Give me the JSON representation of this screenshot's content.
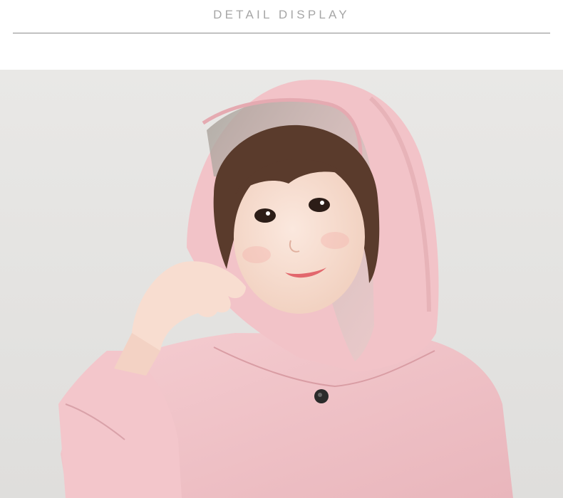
{
  "header": {
    "title": "DETAIL DISPLAY"
  },
  "photo": {
    "subject": "child-in-pink-raincoat",
    "colors": {
      "background": "#e6e6e4",
      "coat": "#f2c5c9",
      "coat_shadow": "#dea5ab",
      "skin": "#f6dccd",
      "hair": "#5a3b2c",
      "visor": "#b9b2a8"
    }
  }
}
